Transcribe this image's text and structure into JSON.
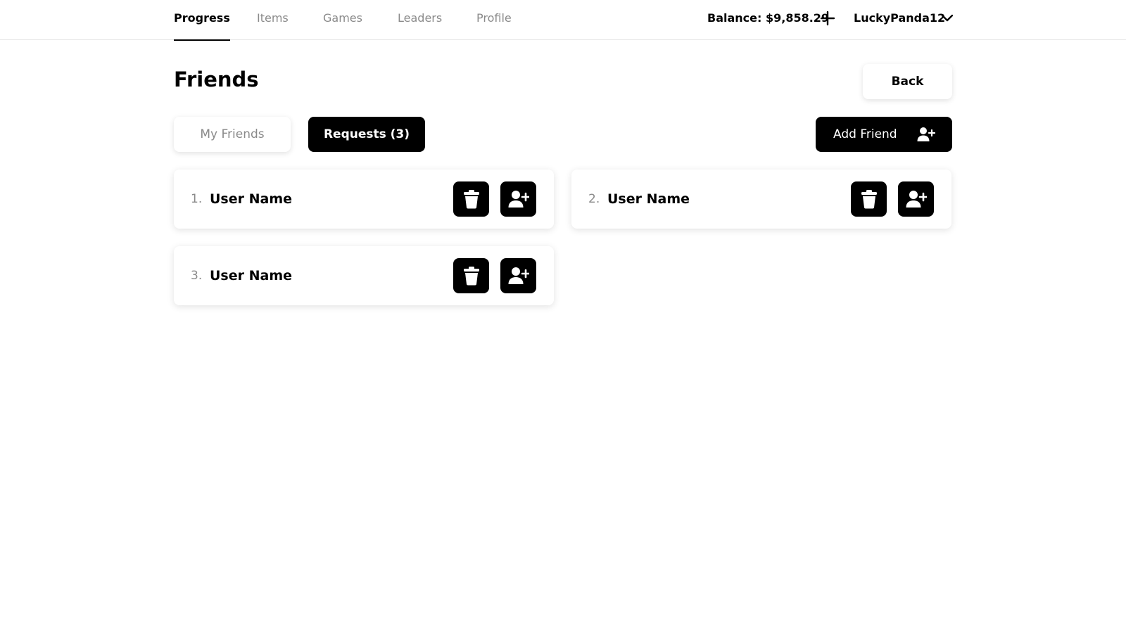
{
  "nav": {
    "tabs": [
      {
        "label": "Progress",
        "active": true
      },
      {
        "label": "Items",
        "active": false
      },
      {
        "label": "Games",
        "active": false
      },
      {
        "label": "Leaders",
        "active": false
      },
      {
        "label": "Profile",
        "active": false
      }
    ],
    "balance": "Balance: $9,858.29",
    "username": "LuckyPanda12"
  },
  "page": {
    "title": "Friends",
    "back_label": "Back"
  },
  "tabs": {
    "my_friends": "My Friends",
    "requests": "Requests (3)",
    "active": "requests"
  },
  "add_friend_label": "Add Friend",
  "requests": [
    {
      "number": "1.",
      "name": "User Name"
    },
    {
      "number": "2.",
      "name": "User Name"
    },
    {
      "number": "3.",
      "name": "User Name"
    }
  ],
  "icons": {
    "add": "plus-icon",
    "account_menu": "chevron-down-icon",
    "add_friend": "user-plus-icon",
    "delete": "trash-icon",
    "accept": "user-plus-icon"
  },
  "colors": {
    "accent": "#000000",
    "muted_text": "#8a8a8a",
    "background": "#ffffff"
  }
}
